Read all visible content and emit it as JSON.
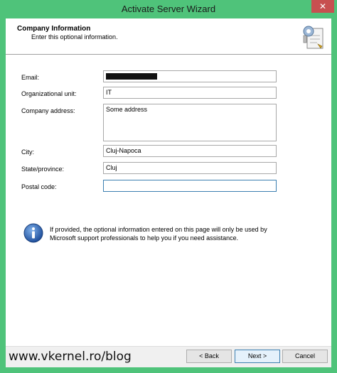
{
  "window": {
    "title": "Activate Server Wizard",
    "close_label": "✕"
  },
  "header": {
    "title": "Company Information",
    "subtitle": "Enter this optional information."
  },
  "form": {
    "email": {
      "label": "Email:",
      "value": ""
    },
    "org_unit": {
      "label": "Organizational unit:",
      "value": "IT"
    },
    "address": {
      "label": "Company address:",
      "value": "Some address"
    },
    "city": {
      "label": "City:",
      "value": "Cluj-Napoca"
    },
    "state": {
      "label": "State/province:",
      "value": "Cluj"
    },
    "postal": {
      "label": "Postal code:",
      "value": ""
    }
  },
  "info": {
    "text": "If provided, the optional information entered on this page will only be used by Microsoft support professionals to help you if you need assistance."
  },
  "footer": {
    "watermark": "www.vkernel.ro/blog",
    "back_label": "< Back",
    "next_label": "Next >",
    "cancel_label": "Cancel"
  }
}
